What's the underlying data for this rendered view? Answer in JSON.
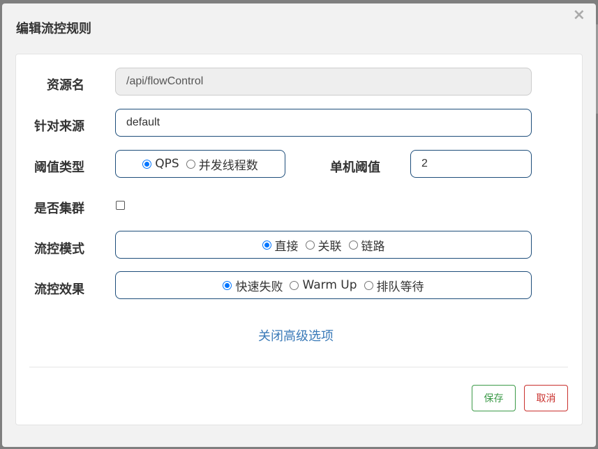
{
  "dialog": {
    "title": "编辑流控规则",
    "close_label": "×"
  },
  "form": {
    "resource": {
      "label": "资源名",
      "value": "/api/flowControl"
    },
    "limit_app": {
      "label": "针对来源",
      "value": "default"
    },
    "grade": {
      "label": "阈值类型",
      "options": [
        {
          "label": "QPS",
          "checked": true
        },
        {
          "label": "并发线程数",
          "checked": false
        }
      ]
    },
    "threshold": {
      "label": "单机阈值",
      "value": "2"
    },
    "cluster": {
      "label": "是否集群",
      "checked": false
    },
    "strategy": {
      "label": "流控模式",
      "options": [
        {
          "label": "直接",
          "checked": true
        },
        {
          "label": "关联",
          "checked": false
        },
        {
          "label": "链路",
          "checked": false
        }
      ]
    },
    "control_behavior": {
      "label": "流控效果",
      "options": [
        {
          "label": "快速失败",
          "checked": true
        },
        {
          "label": "Warm Up",
          "checked": false
        },
        {
          "label": "排队等待",
          "checked": false
        }
      ]
    },
    "advanced_toggle": "关闭高级选项"
  },
  "footer": {
    "save_label": "保存",
    "cancel_label": "取消"
  },
  "colors": {
    "accent": "#0075ff",
    "input_border": "#1d4d7a",
    "link": "#3a7ab8",
    "save": "#3c9a48",
    "cancel": "#c9302c"
  }
}
